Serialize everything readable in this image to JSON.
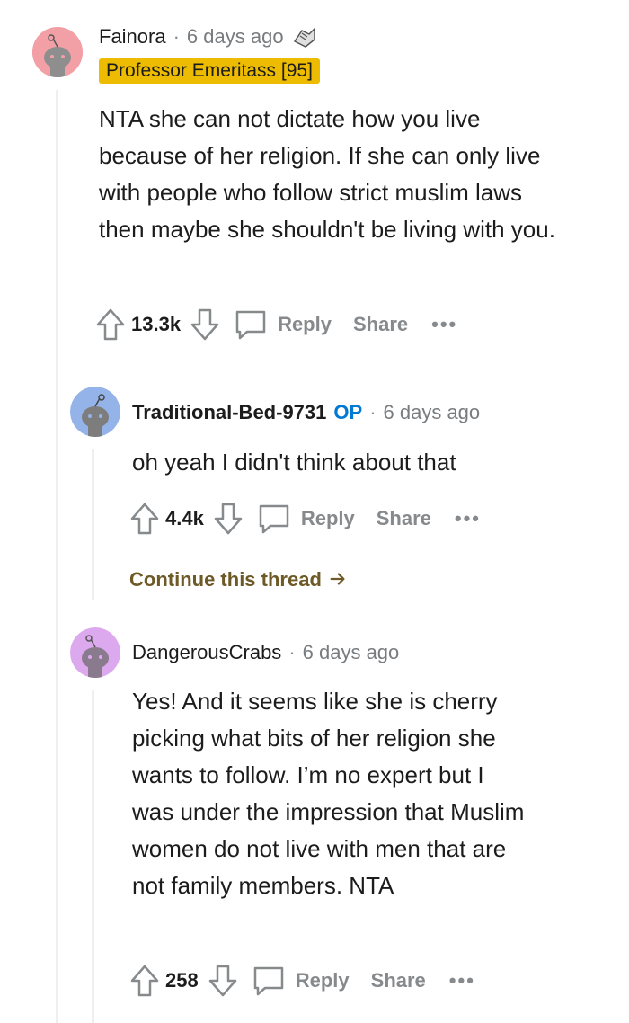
{
  "comments": [
    {
      "username": "Fainora",
      "sep": "·",
      "time": "6 days ago",
      "flair": "Professor Emeritass [95]",
      "body": "NTA she can not dictate how you live because of her religion. If she can only live with people who follow strict muslim laws then maybe she shouldn't be living with you.",
      "score": "13.3k",
      "reply": "Reply",
      "share": "Share",
      "more": "•••",
      "avatar_color": "#f2a0a6"
    },
    {
      "username": "Traditional-Bed-9731",
      "op": "OP",
      "sep": "·",
      "time": "6 days ago",
      "body": "oh yeah I didn't think about that",
      "score": "4.4k",
      "reply": "Reply",
      "share": "Share",
      "more": "•••",
      "continue": "Continue this thread",
      "avatar_color": "#94b3e8"
    },
    {
      "username": "DangerousCrabs",
      "sep": "·",
      "time": "6 days ago",
      "body": "Yes! And it seems like she is cherry picking what bits of her religion she wants to follow. I’m no expert but I was under the impression that Muslim women do not live with men that are not family members. NTA",
      "score": "258",
      "reply": "Reply",
      "share": "Share",
      "more": "•••",
      "avatar_color": "#dca8ee"
    }
  ],
  "colors": {
    "op": "#0079d3",
    "flair_bg": "#edbc00",
    "continue": "#6e5a26",
    "action_gray": "#878a8c"
  },
  "icons": [
    "upvote-icon",
    "downvote-icon",
    "comment-icon",
    "award-icon",
    "arrow-right-icon"
  ]
}
